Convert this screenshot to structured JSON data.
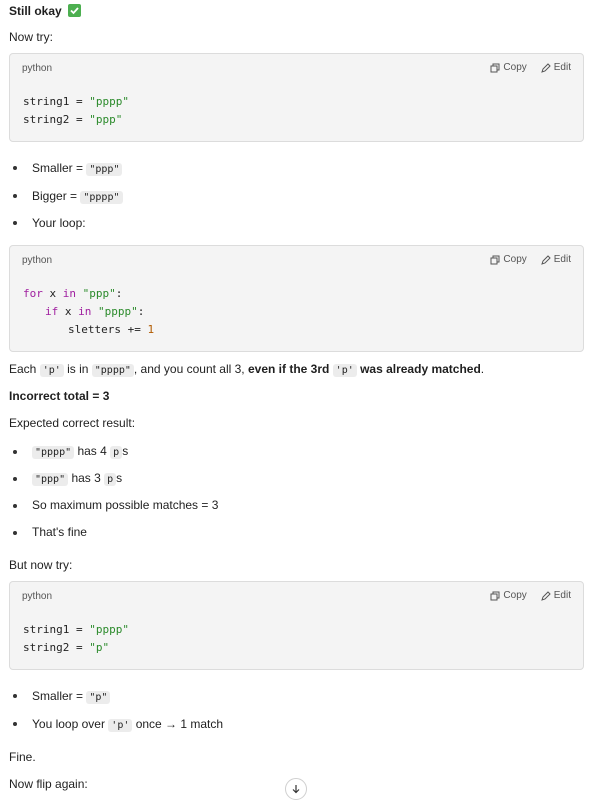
{
  "heading": {
    "text": "Still okay",
    "icon": "check-mark-emoji-icon",
    "icon_color": "#4caf50"
  },
  "intro": "Now try:",
  "code_blocks": [
    {
      "lang": "python",
      "copy": "Copy",
      "edit": "Edit"
    },
    {
      "lang": "python",
      "copy": "Copy",
      "edit": "Edit"
    },
    {
      "lang": "python",
      "copy": "Copy",
      "edit": "Edit"
    }
  ],
  "block1": {
    "l1a": "string1 = ",
    "l1b": "\"pppp\"",
    "l2a": "string2 = ",
    "l2b": "\"ppp\""
  },
  "list1": {
    "smaller": "Smaller = ",
    "smaller_code": "\"ppp\"",
    "bigger": "Bigger = ",
    "bigger_code": "\"pppp\"",
    "loop": "Your loop:"
  },
  "block2": {
    "for": "for",
    "x_in": " x ",
    "in1": "in",
    "str1": " \"ppp\"",
    "colon1": ":",
    "if": "if",
    "x2": " x ",
    "in2": "in",
    "str2": " \"pppp\"",
    "colon2": ":",
    "sletters": "sletters += ",
    "one": "1"
  },
  "each_line": {
    "a": "Each ",
    "c1": "'p'",
    "b": " is in ",
    "c2": "\"pppp\"",
    "c": ", and you count all 3, ",
    "bold1": "even if the 3rd ",
    "c3": "'p'",
    "bold2": " was already matched",
    "d": "."
  },
  "incorrect": "Incorrect total = 3",
  "expected": "Expected correct result:",
  "list2": {
    "i1_code": "\"pppp\"",
    "i1_a": " has 4 ",
    "i1_p": "p",
    "i1_b": "s",
    "i2_code": "\"ppp\"",
    "i2_a": " has 3 ",
    "i2_p": "p",
    "i2_b": "s",
    "i3": "So maximum possible matches = 3",
    "i4": "That's fine"
  },
  "but_now": "But now try:",
  "block3": {
    "l1a": "string1 = ",
    "l1b": "\"pppp\"",
    "l2a": "string2 = ",
    "l2b": "\"p\""
  },
  "list3": {
    "smaller": "Smaller = ",
    "smaller_code": "\"p\"",
    "loop_a": "You loop over ",
    "loop_code": "'p'",
    "loop_b": " once → 1 match"
  },
  "fine": "Fine.",
  "flip": "Now flip again:"
}
